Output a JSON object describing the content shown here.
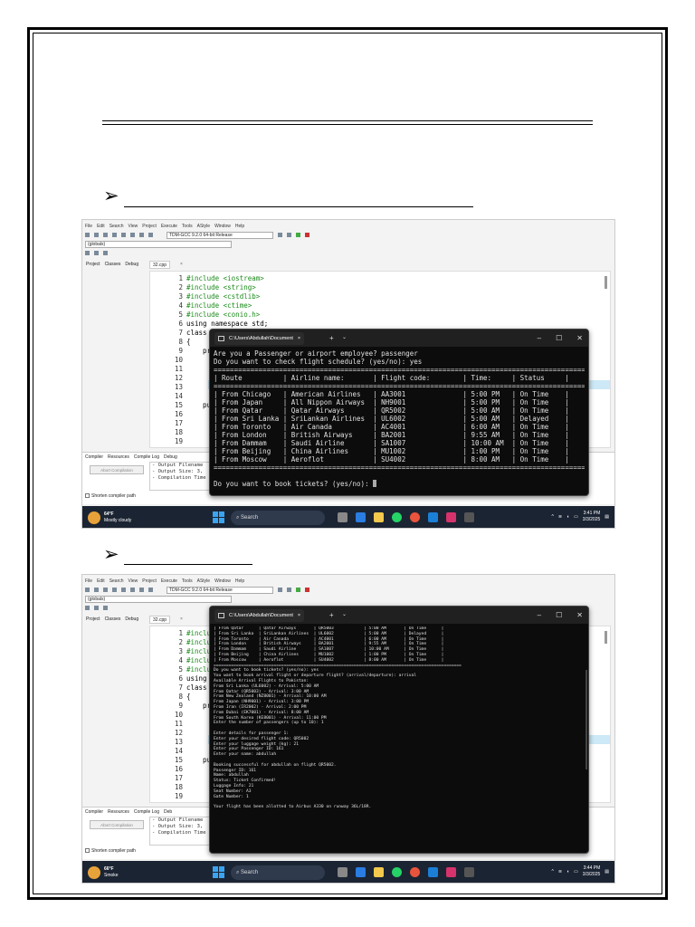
{
  "figures": [
    {
      "menu": [
        "File",
        "Edit",
        "Search",
        "View",
        "Project",
        "Execute",
        "Tools",
        "AStyle",
        "Window",
        "Help"
      ],
      "compiler_select": "TDM-GCC 9.2.0 64-bit Release",
      "scope": "(globals)",
      "panel_tabs": [
        "Project",
        "Classes",
        "Debug"
      ],
      "file_tab": "32.cpp",
      "close_glyph": "×",
      "code_lines": [
        {
          "n": "1",
          "t": "#include <iostream>",
          "pp": true
        },
        {
          "n": "2",
          "t": "#include <string>",
          "pp": true
        },
        {
          "n": "3",
          "t": "#include <cstdlib>",
          "pp": true
        },
        {
          "n": "4",
          "t": "#include <ctime>",
          "pp": true
        },
        {
          "n": "5",
          "t": "#include <conio.h>",
          "pp": true
        },
        {
          "n": "6",
          "t": "using namespace std;"
        },
        {
          "n": "7",
          "t": "class Fli"
        },
        {
          "n": "8",
          "t": "{"
        },
        {
          "n": "9",
          "t": "    prote"
        },
        {
          "n": "10",
          "t": "        t"
        },
        {
          "n": "11",
          "t": "        i"
        },
        {
          "n": "12",
          "t": "        i"
        },
        {
          "n": "13",
          "t": "        i"
        },
        {
          "n": "14",
          "t": "        s"
        },
        {
          "n": "15",
          "t": "    publi"
        },
        {
          "n": "16",
          "t": "        F"
        },
        {
          "n": "17",
          "t": "        {"
        },
        {
          "n": "18",
          "t": ""
        },
        {
          "n": "19",
          "t": ""
        }
      ],
      "bottom_tabs": [
        "Compiler",
        "Resources",
        "Compile Log",
        "Debug"
      ],
      "abort_label": "Abort Compilation",
      "output_lines": [
        "- Output Filename",
        "- Output Size: 3,",
        "- Compilation Time"
      ],
      "shorten_label": "Shorten compiler path",
      "weather_temp": "64°F",
      "weather_desc": "Mostly cloudy",
      "search_label": "Search",
      "clock_time": "3:41 PM",
      "clock_date": "3/3/2025",
      "terminal_title": "C:\\Users\\Abdullah\\Document",
      "terminal_lines": [
        "Are you a Passenger or airport employee? passenger",
        "Do you want to check flight schedule? (yes/no): yes",
        "===========================================================================================",
        "| Route          | Airline name:       | Flight code:        | Time:     | Status     |",
        "===========================================================================================",
        "| From Chicago   | American Airlines   | AA3001              | 5:00 PM   | On Time    |",
        "| From Japan     | All Nippon Airways  | NH9001              | 5:00 PM   | On Time    |",
        "| From Qatar     | Qatar Airways       | QR5002              | 5:00 AM   | On Time    |",
        "| From Sri Lanka | SriLankan Airlines  | UL6002              | 5:00 AM   | Delayed    |",
        "| From Toronto   | Air Canada          | AC4001              | 6:00 AM   | On Time    |",
        "| From London    | British Airways     | BA2001              | 9:55 AM   | On Time    |",
        "| From Dammam    | Saudi Airline       | SA1007              | 10:00 AM  | On Time    |",
        "| From Beijing   | China Airlines      | MU1002              | 1:00 PM   | On Time    |",
        "| From Moscow    | Aeroflot            | SU4002              | 8:00 AM   | On Time    |",
        "===========================================================================================",
        "",
        "Do you want to book tickets? (yes/no): "
      ]
    },
    {
      "menu": [
        "File",
        "Edit",
        "Search",
        "View",
        "Project",
        "Execute",
        "Tools",
        "AStyle",
        "Window",
        "Help"
      ],
      "compiler_select": "TDM-GCC 9.2.0 64-bit Release",
      "scope": "(globals)",
      "panel_tabs": [
        "Project",
        "Classes",
        "Debug"
      ],
      "file_tab": "32.cpp",
      "close_glyph": "×",
      "code_lines": [
        {
          "n": "1",
          "t": "#include",
          "pp": true
        },
        {
          "n": "2",
          "t": "#include",
          "pp": true
        },
        {
          "n": "3",
          "t": "#include",
          "pp": true
        },
        {
          "n": "4",
          "t": "#include",
          "pp": true
        },
        {
          "n": "5",
          "t": "#include",
          "pp": true
        },
        {
          "n": "6",
          "t": "using nam"
        },
        {
          "n": "7",
          "t": "class Fl"
        },
        {
          "n": "8",
          "t": "{"
        },
        {
          "n": "9",
          "t": "    prot"
        },
        {
          "n": "10",
          "t": ""
        },
        {
          "n": "11",
          "t": ""
        },
        {
          "n": "12",
          "t": ""
        },
        {
          "n": "13",
          "t": ""
        },
        {
          "n": "14",
          "t": ""
        },
        {
          "n": "15",
          "t": "    publ"
        },
        {
          "n": "16",
          "t": ""
        },
        {
          "n": "17",
          "t": ""
        },
        {
          "n": "18",
          "t": ""
        },
        {
          "n": "19",
          "t": ""
        }
      ],
      "bottom_tabs": [
        "Compiler",
        "Resources",
        "Compile Log",
        "Deb"
      ],
      "abort_label": "Abort Compilation",
      "output_lines": [
        "- Output Filename",
        "- Output Size: 3,",
        "- Compilation Time"
      ],
      "shorten_label": "Shorten compiler path",
      "weather_temp": "66°F",
      "weather_desc": "Smoke",
      "search_label": "Search",
      "clock_time": "3:44 PM",
      "clock_date": "3/3/2025",
      "terminal_title": "C:\\Users\\Abdullah\\Document",
      "terminal_lines": [
        "| From Qatar      | Qatar Airways       | QR5003            | 5:00 AM       | On Time      |",
        "| From Sri Lanka  | SriLankan Airlines  | UL6002            | 5:00 AM       | Delayed      |",
        "| From Toronto    | Air Canada          | AC4001            | 6:00 AM       | On Time      |",
        "| From London     | British Airways     | BA2001            | 9:55 AM       | On Time      |",
        "| From Dammam     | Saudi Airline       | SA1007            | 10:00 AM      | On Time      |",
        "| From Beijing    | China Airlines      | MU1002            | 1:00 PM       | On Time      |",
        "| From Moscow     | Aeroflot            | SU4002            | 8:00 AM       | On Time      |",
        "===================================================================================================",
        "Do you want to book tickets? (yes/no): yes",
        "You want to book arrival flight or departure flight? (arrival/departure): arrival",
        "Available Arrival Flights to Pakistan:",
        "From Sri Lanka (UL6002) - Arrival: 5:00 AM",
        "From Qatar (QR5003) - Arrival: 3:00 AM",
        "From New Zealand (NZ8001) - Arrival: 10:00 AM",
        "From Japan (NH9001) - Arrival: 3:00 PM",
        "From Iran (IR2002) - Arrival: 2:00 PM",
        "From Dubai (EK7001) - Arrival: 8:00 AM",
        "From South Korea (KE8001) - Arrival: 11:00 PM",
        "Enter the number of passengers (up to 10): 1",
        "",
        "Enter details for passenger 1:",
        "Enter your desired flight code: QR5002",
        "Enter your luggage weight (kg): 21",
        "Enter your Passenger ID: 161",
        "Enter your name: abdullah",
        "",
        "Booking successful for abdullah on flight QR5002.",
        "Passenger ID: 161",
        "Name: abdullah",
        "Status: Ticket Confirmed!",
        "Luggage Info: 21",
        "Seat Number: A3",
        "Gate Number: 1",
        "",
        "Your flight has been allotted to Airbus A330 on runway 36L/18R."
      ]
    }
  ]
}
